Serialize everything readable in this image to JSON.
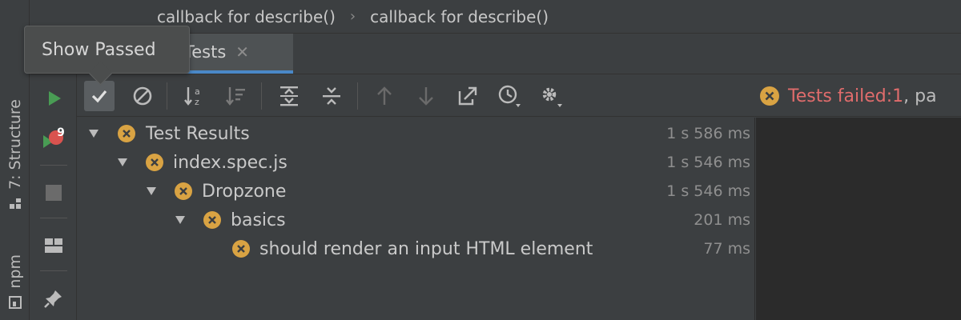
{
  "breadcrumb": {
    "items": [
      "callback for describe()",
      "callback for describe()"
    ]
  },
  "tab": {
    "label": "Tests"
  },
  "tooltip": {
    "text": "Show Passed"
  },
  "tool_stripe": {
    "structure_label": "7: Structure",
    "npm_label": "npm"
  },
  "action_column": {
    "rerun_failed_badge": "9"
  },
  "status": {
    "prefix": "Tests failed: ",
    "failed_count": "1",
    "suffix": ", pa"
  },
  "tree": {
    "rows": [
      {
        "name": "Test Results",
        "duration": "1 s 586 ms",
        "expandable": true,
        "depth": 0
      },
      {
        "name": "index.spec.js",
        "duration": "1 s 546 ms",
        "expandable": true,
        "depth": 1
      },
      {
        "name": "Dropzone",
        "duration": "1 s 546 ms",
        "expandable": true,
        "depth": 2
      },
      {
        "name": "basics",
        "duration": "201 ms",
        "expandable": true,
        "depth": 3
      },
      {
        "name": "should render an input HTML element",
        "duration": "77 ms",
        "expandable": false,
        "depth": 4
      }
    ]
  },
  "icons": {
    "status": "failed-test-icon",
    "toolbar": [
      "show-passed-icon",
      "show-ignored-icon",
      "sort-alphabetically-icon",
      "sort-by-duration-icon",
      "expand-all-icon",
      "collapse-all-icon",
      "previous-failed-icon",
      "next-failed-icon",
      "export-icon",
      "test-history-icon",
      "settings-icon"
    ]
  },
  "colors": {
    "accent": "#4a88c7",
    "fail_text": "#e06c6c",
    "fail_icon": "#d9a343",
    "run_green": "#499c54"
  }
}
